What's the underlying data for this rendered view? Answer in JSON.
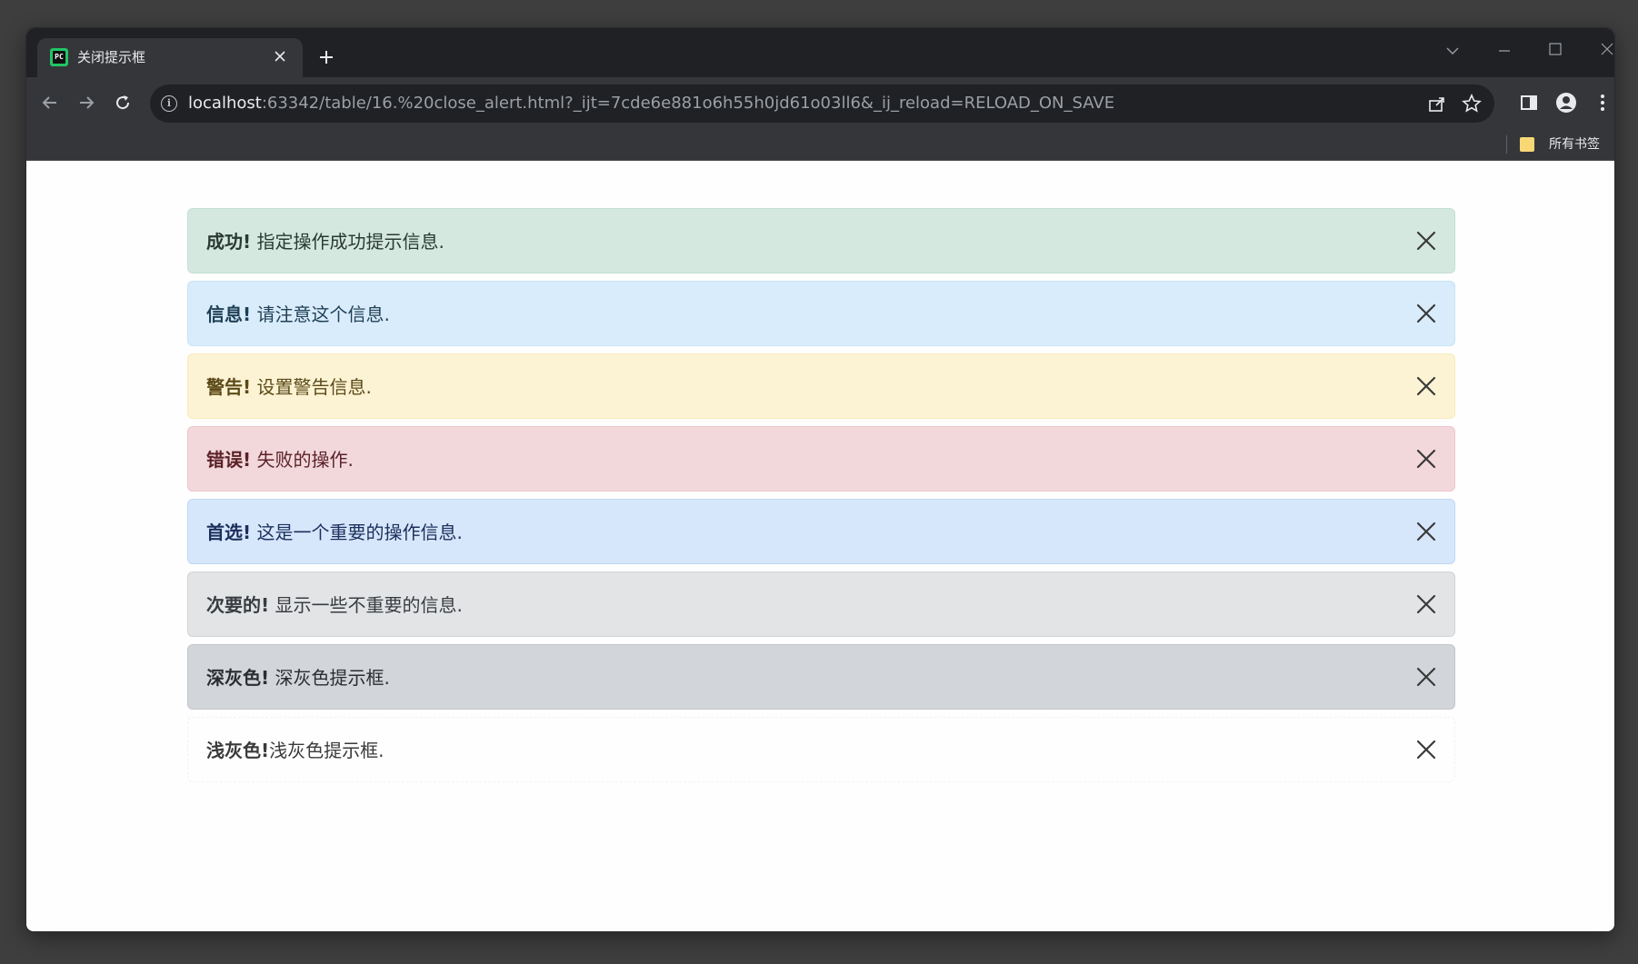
{
  "browser": {
    "tab_title": "关闭提示框",
    "tab_favicon_text": "PC",
    "url_host": "localhost",
    "url_rest": ":63342/table/16.%20close_alert.html?_ijt=7cde6e881o6h55h0jd61o03ll6&_ij_reload=RELOAD_ON_SAVE",
    "bookmarks_label": "所有书签"
  },
  "alerts": [
    {
      "title": "成功!",
      "text": " 指定操作成功提示信息.",
      "bg": "#d5e8e0",
      "border": "#c3e0d2",
      "color": "#2a3a32"
    },
    {
      "title": "信息!",
      "text": " 请注意这个信息.",
      "bg": "#d9ecfb",
      "border": "#c6e3f5",
      "color": "#1f3f55"
    },
    {
      "title": "警告!",
      "text": " 设置警告信息.",
      "bg": "#fcf3d4",
      "border": "#f8ebbd",
      "color": "#5b4a18"
    },
    {
      "title": "错误!",
      "text": " 失败的操作.",
      "bg": "#f2d8db",
      "border": "#eec6cb",
      "color": "#5b2228"
    },
    {
      "title": "首选!",
      "text": " 这是一个重要的操作信息.",
      "bg": "#d7e7fb",
      "border": "#bfd7f5",
      "color": "#1b2f5c"
    },
    {
      "title": "次要的!",
      "text": " 显示一些不重要的信息.",
      "bg": "#e3e4e6",
      "border": "#d2d3d6",
      "color": "#383d41"
    },
    {
      "title": "深灰色!",
      "text": " 深灰色提示框.",
      "bg": "#d2d5da",
      "border": "#c2c5cb",
      "color": "#2a2d31"
    },
    {
      "title": "浅灰色!",
      "text": "浅灰色提示框.",
      "bg": "#fefefe",
      "border": "#f2f2f2",
      "color": "#3a3a3a"
    }
  ]
}
